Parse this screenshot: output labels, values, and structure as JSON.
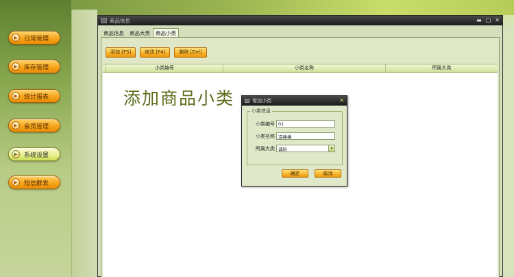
{
  "sidebar": {
    "items": [
      {
        "label": "日常管理",
        "icon": "arrow-right-icon",
        "selected": false
      },
      {
        "label": "库存管理",
        "icon": "arrow-right-icon",
        "selected": false
      },
      {
        "label": "统计报表",
        "icon": "arrow-right-icon",
        "selected": false
      },
      {
        "label": "会员管理",
        "icon": "arrow-right-icon",
        "selected": false
      },
      {
        "label": "系统设置",
        "icon": "arrow-right-icon",
        "selected": true
      },
      {
        "label": "短信群发",
        "icon": "arrow-right-icon",
        "selected": false
      }
    ]
  },
  "window": {
    "title": "商品信息",
    "controls": [
      "minimize-icon",
      "maximize-icon",
      "close-icon"
    ]
  },
  "tabs": [
    {
      "label": "商品信息",
      "active": false
    },
    {
      "label": "商品大类",
      "active": false
    },
    {
      "label": "商品小类",
      "active": true
    }
  ],
  "toolbar": {
    "add_label": "添加 [F5]",
    "edit_label": "修改 [F4]",
    "delete_label": "删除 [Del]"
  },
  "grid": {
    "columns": [
      "小类编号",
      "小类名称",
      "所属大类"
    ],
    "watermark": "添加商品小类"
  },
  "dialog": {
    "title": "增加小类",
    "group_title": "小类信息",
    "fields": {
      "code": {
        "label": "小类编号",
        "value": "01"
      },
      "name": {
        "label": "小类名称",
        "value": "凉拌类"
      },
      "category": {
        "label": "所属大类",
        "value": "调料"
      }
    },
    "ok_label": "确定",
    "cancel_label": "取消"
  },
  "colors": {
    "accent_orange": "#f7a51c",
    "selected_green": "#e9f08e",
    "titlebar_dark": "#1c1c1c",
    "watermark_green": "#5c6e1c"
  }
}
